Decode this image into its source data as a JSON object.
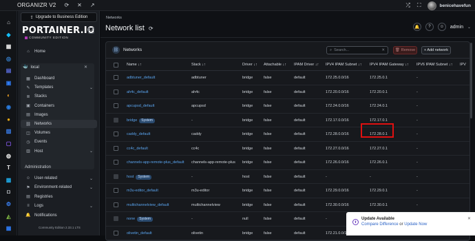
{
  "topbar": {
    "app_title": "ORGANIZR V2",
    "user_name": "benicehavefun",
    "icons": [
      "refresh-icon",
      "close-icon",
      "expand-icon",
      "shuffle-icon",
      "fullscreen-icon"
    ]
  },
  "rail": {
    "items": [
      {
        "name": "home",
        "color": "#cfd3d8",
        "glyph": "⌂"
      },
      {
        "name": "portainer",
        "color": "#13bef9",
        "glyph": "◆"
      },
      {
        "name": "app-2",
        "color": "#e6e6e6",
        "glyph": "▦"
      },
      {
        "name": "app-3",
        "color": "#3a8ee6",
        "glyph": "◎"
      },
      {
        "name": "app-4",
        "color": "#5b6ee1",
        "glyph": "▤"
      },
      {
        "name": "app-5",
        "color": "#2e7cf6",
        "glyph": "▣"
      },
      {
        "name": "app-6",
        "color": "#f5a524",
        "glyph": "◐"
      },
      {
        "name": "app-7",
        "color": "#2a7de1",
        "glyph": "◉"
      },
      {
        "name": "app-8",
        "color": "#e6a817",
        "glyph": "●"
      },
      {
        "name": "app-9",
        "color": "#3b82f6",
        "glyph": "▥"
      },
      {
        "name": "app-10",
        "color": "#8b5cf6",
        "glyph": "▢"
      },
      {
        "name": "app-11",
        "color": "#e6e6e6",
        "glyph": "◍"
      },
      {
        "name": "app-12",
        "color": "#eaeaea",
        "glyph": "T"
      },
      {
        "name": "app-13",
        "color": "#1ea5e0",
        "glyph": "▩"
      },
      {
        "name": "app-14",
        "color": "#d8dde3",
        "glyph": "◘"
      },
      {
        "name": "app-15",
        "color": "#3b82f6",
        "glyph": "⚙"
      },
      {
        "name": "app-16",
        "color": "#7cb342",
        "glyph": "◭"
      },
      {
        "name": "app-17",
        "color": "#2e7cf6",
        "glyph": "▦"
      }
    ]
  },
  "sidebar": {
    "upgrade_label": "Upgrade to Business Edition",
    "logo": "PORTAINER.IO",
    "edition": "COMMUNITY EDITION",
    "home_label": "Home",
    "env_name": "local",
    "env_items": [
      {
        "label": "Dashboard",
        "icon": "dashboard-icon",
        "chevron": false,
        "active": false
      },
      {
        "label": "Templates",
        "icon": "templates-icon",
        "chevron": true,
        "active": false
      },
      {
        "label": "Stacks",
        "icon": "stacks-icon",
        "chevron": false,
        "active": false
      },
      {
        "label": "Containers",
        "icon": "containers-icon",
        "chevron": false,
        "active": false
      },
      {
        "label": "Images",
        "icon": "images-icon",
        "chevron": false,
        "active": false
      },
      {
        "label": "Networks",
        "icon": "networks-icon",
        "chevron": false,
        "active": true
      },
      {
        "label": "Volumes",
        "icon": "volumes-icon",
        "chevron": false,
        "active": false
      },
      {
        "label": "Events",
        "icon": "events-icon",
        "chevron": false,
        "active": false
      },
      {
        "label": "Host",
        "icon": "host-icon",
        "chevron": true,
        "active": false
      }
    ],
    "admin_section": "Administration",
    "admin_items": [
      {
        "label": "User-related",
        "icon": "users-icon",
        "chevron": true
      },
      {
        "label": "Environment-related",
        "icon": "environment-icon",
        "chevron": true
      },
      {
        "label": "Registries",
        "icon": "registries-icon",
        "chevron": false
      },
      {
        "label": "Logs",
        "icon": "logs-icon",
        "chevron": true
      },
      {
        "label": "Notifications",
        "icon": "bell-icon",
        "chevron": false
      }
    ],
    "footer": "Community Edition 2.33.1 LTS"
  },
  "main": {
    "breadcrumb": "Networks",
    "title": "Network list",
    "user": "admin",
    "card_title": "Networks",
    "search_placeholder": "Search...",
    "remove_label": "Remove",
    "add_label": "+ Add network",
    "columns": [
      "Name ↓↑",
      "Stack ↓↑",
      "Driver ↓↑",
      "Attachable ↓↑",
      "IPAM Driver ↓↑",
      "IPV4 IPAM Subnet ↓↑",
      "IPV4 IPAM Gateway ↓↑",
      "IPV6 IPAM Subnet ↓↑",
      "IPV"
    ],
    "rows": [
      {
        "name": "adbtuner_default",
        "system": false,
        "stack": "adbtuner",
        "driver": "bridge",
        "attachable": "false",
        "ipam": "default",
        "subnet": "172.25.0.0/16",
        "gateway": "172.25.0.1",
        "ipv6": "-"
      },
      {
        "name": "ah4c_default",
        "system": false,
        "stack": "ah4c",
        "driver": "bridge",
        "attachable": "false",
        "ipam": "default",
        "subnet": "172.20.0.0/16",
        "gateway": "172.20.0.1",
        "ipv6": "-"
      },
      {
        "name": "apcupsd_default",
        "system": false,
        "stack": "apcupsd",
        "driver": "bridge",
        "attachable": "false",
        "ipam": "default",
        "subnet": "172.24.0.0/16",
        "gateway": "172.24.0.1",
        "ipv6": "-"
      },
      {
        "name": "bridge",
        "system": true,
        "stack": "-",
        "driver": "bridge",
        "attachable": "false",
        "ipam": "default",
        "subnet": "172.17.0.0/16",
        "gateway": "172.17.0.1",
        "ipv6": "-"
      },
      {
        "name": "caddy_default",
        "system": false,
        "stack": "caddy",
        "driver": "bridge",
        "attachable": "false",
        "ipam": "default",
        "subnet": "172.28.0.0/16",
        "gateway": "172.28.0.1",
        "ipv6": "-"
      },
      {
        "name": "cc4c_default",
        "system": false,
        "stack": "cc4c",
        "driver": "bridge",
        "attachable": "false",
        "ipam": "default",
        "subnet": "172.27.0.0/16",
        "gateway": "172.27.0.1",
        "ipv6": "-"
      },
      {
        "name": "channels-app-remote-plus_default",
        "system": false,
        "stack": "channels-app-remote-plus",
        "driver": "bridge",
        "attachable": "false",
        "ipam": "default",
        "subnet": "172.26.0.0/16",
        "gateway": "172.26.0.1",
        "ipv6": "-"
      },
      {
        "name": "host",
        "system": true,
        "stack": "-",
        "driver": "host",
        "attachable": "false",
        "ipam": "default",
        "subnet": "-",
        "gateway": "-",
        "ipv6": "-"
      },
      {
        "name": "m3u-editor_default",
        "system": false,
        "stack": "m3u-editor",
        "driver": "bridge",
        "attachable": "false",
        "ipam": "default",
        "subnet": "172.29.0.0/16",
        "gateway": "172.29.0.1",
        "ipv6": "-"
      },
      {
        "name": "multichannelview_default",
        "system": false,
        "stack": "multichannelview",
        "driver": "bridge",
        "attachable": "false",
        "ipam": "default",
        "subnet": "172.30.0.0/16",
        "gateway": "172.30.0.1",
        "ipv6": "-"
      },
      {
        "name": "none",
        "system": true,
        "stack": "-",
        "driver": "null",
        "attachable": "false",
        "ipam": "default",
        "subnet": "-",
        "gateway": "-",
        "ipv6": "-"
      },
      {
        "name": "olivetin_default",
        "system": false,
        "stack": "olivetin",
        "driver": "bridge",
        "attachable": "false",
        "ipam": "default",
        "subnet": "172.21.0.0/16",
        "gateway": "172.21.0.1",
        "ipv6": "-"
      }
    ],
    "system_badge": "System"
  },
  "toast": {
    "title": "Update Available",
    "link1": "Compare Difference",
    "or": " or ",
    "link2": "Update Now"
  },
  "colors": {
    "accent": "#5aa4ee",
    "highlight": "#e01010",
    "badge": "#2a4a6e"
  }
}
